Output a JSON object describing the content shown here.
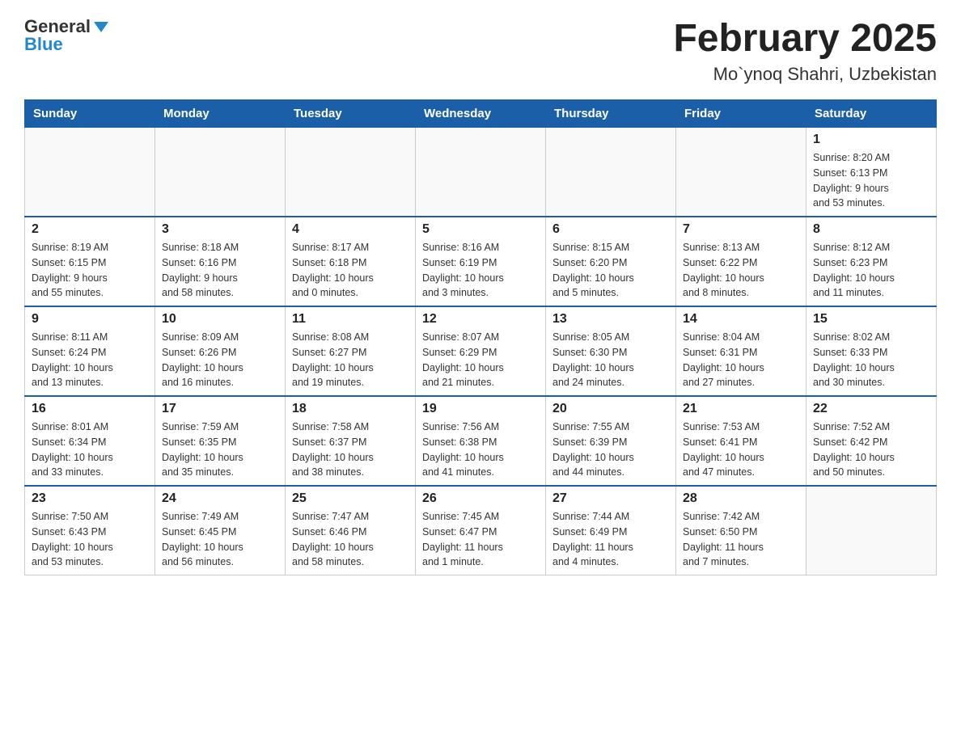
{
  "header": {
    "logo_general": "General",
    "logo_blue": "Blue",
    "title": "February 2025",
    "subtitle": "Mo`ynoq Shahri, Uzbekistan"
  },
  "weekdays": [
    "Sunday",
    "Monday",
    "Tuesday",
    "Wednesday",
    "Thursday",
    "Friday",
    "Saturday"
  ],
  "weeks": [
    [
      {
        "day": "",
        "info": ""
      },
      {
        "day": "",
        "info": ""
      },
      {
        "day": "",
        "info": ""
      },
      {
        "day": "",
        "info": ""
      },
      {
        "day": "",
        "info": ""
      },
      {
        "day": "",
        "info": ""
      },
      {
        "day": "1",
        "info": "Sunrise: 8:20 AM\nSunset: 6:13 PM\nDaylight: 9 hours\nand 53 minutes."
      }
    ],
    [
      {
        "day": "2",
        "info": "Sunrise: 8:19 AM\nSunset: 6:15 PM\nDaylight: 9 hours\nand 55 minutes."
      },
      {
        "day": "3",
        "info": "Sunrise: 8:18 AM\nSunset: 6:16 PM\nDaylight: 9 hours\nand 58 minutes."
      },
      {
        "day": "4",
        "info": "Sunrise: 8:17 AM\nSunset: 6:18 PM\nDaylight: 10 hours\nand 0 minutes."
      },
      {
        "day": "5",
        "info": "Sunrise: 8:16 AM\nSunset: 6:19 PM\nDaylight: 10 hours\nand 3 minutes."
      },
      {
        "day": "6",
        "info": "Sunrise: 8:15 AM\nSunset: 6:20 PM\nDaylight: 10 hours\nand 5 minutes."
      },
      {
        "day": "7",
        "info": "Sunrise: 8:13 AM\nSunset: 6:22 PM\nDaylight: 10 hours\nand 8 minutes."
      },
      {
        "day": "8",
        "info": "Sunrise: 8:12 AM\nSunset: 6:23 PM\nDaylight: 10 hours\nand 11 minutes."
      }
    ],
    [
      {
        "day": "9",
        "info": "Sunrise: 8:11 AM\nSunset: 6:24 PM\nDaylight: 10 hours\nand 13 minutes."
      },
      {
        "day": "10",
        "info": "Sunrise: 8:09 AM\nSunset: 6:26 PM\nDaylight: 10 hours\nand 16 minutes."
      },
      {
        "day": "11",
        "info": "Sunrise: 8:08 AM\nSunset: 6:27 PM\nDaylight: 10 hours\nand 19 minutes."
      },
      {
        "day": "12",
        "info": "Sunrise: 8:07 AM\nSunset: 6:29 PM\nDaylight: 10 hours\nand 21 minutes."
      },
      {
        "day": "13",
        "info": "Sunrise: 8:05 AM\nSunset: 6:30 PM\nDaylight: 10 hours\nand 24 minutes."
      },
      {
        "day": "14",
        "info": "Sunrise: 8:04 AM\nSunset: 6:31 PM\nDaylight: 10 hours\nand 27 minutes."
      },
      {
        "day": "15",
        "info": "Sunrise: 8:02 AM\nSunset: 6:33 PM\nDaylight: 10 hours\nand 30 minutes."
      }
    ],
    [
      {
        "day": "16",
        "info": "Sunrise: 8:01 AM\nSunset: 6:34 PM\nDaylight: 10 hours\nand 33 minutes."
      },
      {
        "day": "17",
        "info": "Sunrise: 7:59 AM\nSunset: 6:35 PM\nDaylight: 10 hours\nand 35 minutes."
      },
      {
        "day": "18",
        "info": "Sunrise: 7:58 AM\nSunset: 6:37 PM\nDaylight: 10 hours\nand 38 minutes."
      },
      {
        "day": "19",
        "info": "Sunrise: 7:56 AM\nSunset: 6:38 PM\nDaylight: 10 hours\nand 41 minutes."
      },
      {
        "day": "20",
        "info": "Sunrise: 7:55 AM\nSunset: 6:39 PM\nDaylight: 10 hours\nand 44 minutes."
      },
      {
        "day": "21",
        "info": "Sunrise: 7:53 AM\nSunset: 6:41 PM\nDaylight: 10 hours\nand 47 minutes."
      },
      {
        "day": "22",
        "info": "Sunrise: 7:52 AM\nSunset: 6:42 PM\nDaylight: 10 hours\nand 50 minutes."
      }
    ],
    [
      {
        "day": "23",
        "info": "Sunrise: 7:50 AM\nSunset: 6:43 PM\nDaylight: 10 hours\nand 53 minutes."
      },
      {
        "day": "24",
        "info": "Sunrise: 7:49 AM\nSunset: 6:45 PM\nDaylight: 10 hours\nand 56 minutes."
      },
      {
        "day": "25",
        "info": "Sunrise: 7:47 AM\nSunset: 6:46 PM\nDaylight: 10 hours\nand 58 minutes."
      },
      {
        "day": "26",
        "info": "Sunrise: 7:45 AM\nSunset: 6:47 PM\nDaylight: 11 hours\nand 1 minute."
      },
      {
        "day": "27",
        "info": "Sunrise: 7:44 AM\nSunset: 6:49 PM\nDaylight: 11 hours\nand 4 minutes."
      },
      {
        "day": "28",
        "info": "Sunrise: 7:42 AM\nSunset: 6:50 PM\nDaylight: 11 hours\nand 7 minutes."
      },
      {
        "day": "",
        "info": ""
      }
    ]
  ]
}
